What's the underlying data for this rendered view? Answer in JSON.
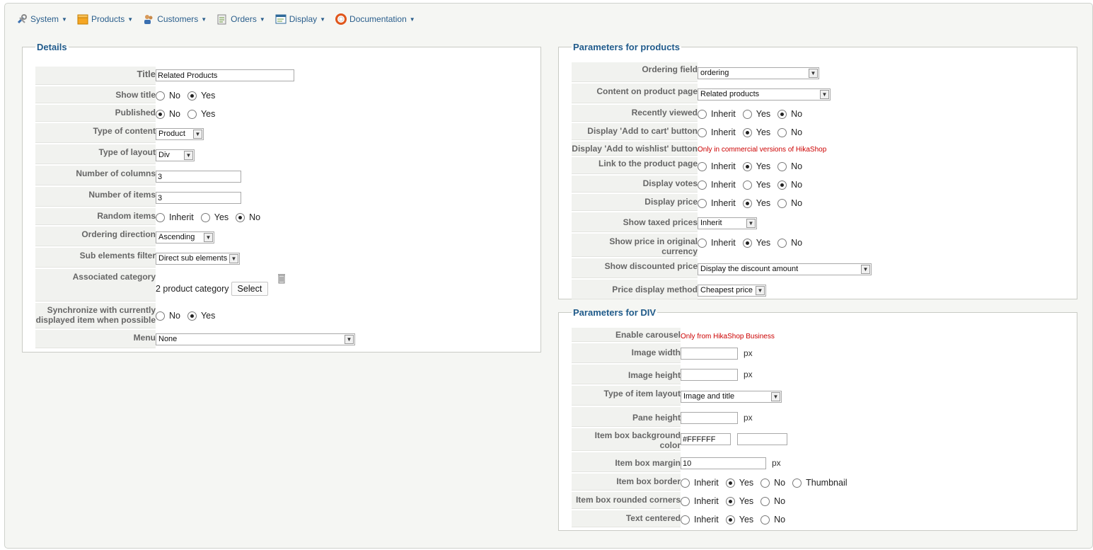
{
  "menu": [
    {
      "label": "System",
      "icon": "wrench-icon"
    },
    {
      "label": "Products",
      "icon": "box-icon"
    },
    {
      "label": "Customers",
      "icon": "users-icon"
    },
    {
      "label": "Orders",
      "icon": "orders-icon"
    },
    {
      "label": "Display",
      "icon": "display-icon"
    },
    {
      "label": "Documentation",
      "icon": "lifebuoy-icon"
    }
  ],
  "details": {
    "legend": "Details",
    "title_label": "Title",
    "title_value": "Related Products",
    "show_title_label": "Show title",
    "published_label": "Published",
    "type_content_label": "Type of content",
    "type_content_value": "Product",
    "type_layout_label": "Type of layout",
    "type_layout_value": "Div",
    "num_columns_label": "Number of columns",
    "num_columns_value": "3",
    "num_items_label": "Number of items",
    "num_items_value": "3",
    "random_items_label": "Random items",
    "ordering_dir_label": "Ordering direction",
    "ordering_dir_value": "Ascending",
    "sub_filter_label": "Sub elements filter",
    "sub_filter_value": "Direct sub elements",
    "assoc_cat_label": "Associated category",
    "assoc_cat_value": "2 product category",
    "select_button": "Select",
    "sync_label_1": "Synchronize with currently",
    "sync_label_2": "displayed item when possible",
    "menu_label": "Menu",
    "menu_value": "None"
  },
  "opts": {
    "no": "No",
    "yes": "Yes",
    "inherit": "Inherit",
    "thumbnail": "Thumbnail",
    "px": "px"
  },
  "products": {
    "legend": "Parameters for products",
    "ordering_field_label": "Ordering field",
    "ordering_field_value": "ordering",
    "content_page_label": "Content on product page",
    "content_page_value": "Related products",
    "recently_viewed_label": "Recently viewed",
    "add_cart_label": "Display 'Add to cart' button",
    "add_wishlist_label": "Display 'Add to wishlist' button",
    "add_wishlist_note": "Only in commercial versions of HikaShop",
    "link_product_label": "Link to the product page",
    "votes_label": "Display votes",
    "price_label": "Display price",
    "taxed_label": "Show taxed prices",
    "taxed_value": "Inherit",
    "orig_currency_label": "Show price in original currency",
    "discount_label": "Show discounted price",
    "discount_value": "Display the discount amount",
    "price_method_label": "Price display method",
    "price_method_value": "Cheapest price"
  },
  "div": {
    "legend": "Parameters for DIV",
    "carousel_label": "Enable carousel",
    "carousel_note": "Only from HikaShop Business",
    "img_width_label": "Image width",
    "img_height_label": "Image height",
    "item_layout_label": "Type of item layout",
    "item_layout_value": "Image and title",
    "pane_height_label": "Pane height",
    "bg_color_label": "Item box background color",
    "bg_color_value": "#FFFFFF",
    "margin_label": "Item box margin",
    "margin_value": "10",
    "border_label": "Item box border",
    "rounded_label": "Item box rounded corners",
    "centered_label": "Text centered"
  }
}
